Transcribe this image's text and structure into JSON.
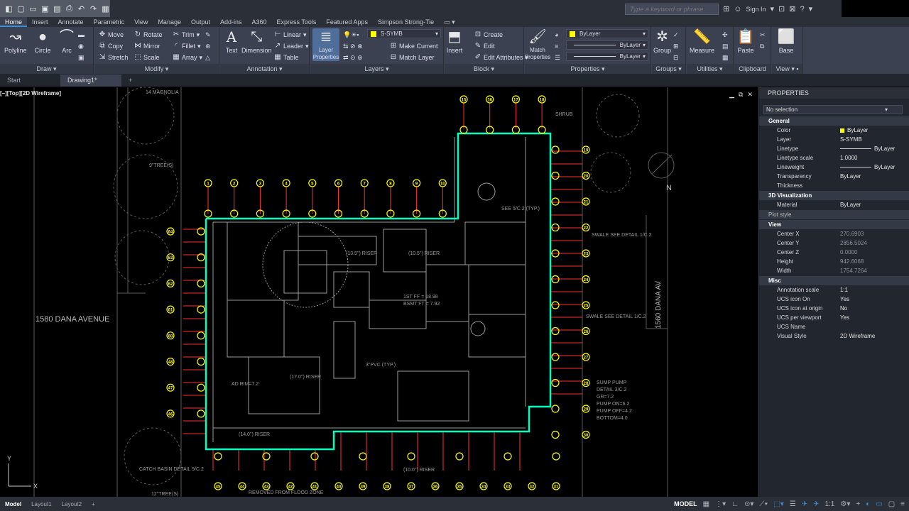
{
  "qat": [
    "new-icon",
    "open-icon",
    "save-icon",
    "saveas-icon",
    "print-icon",
    "undo-icon",
    "redo-icon",
    "share-icon"
  ],
  "search": {
    "placeholder": "Type a keyword or phrase",
    "signin": "Sign In"
  },
  "tabs": [
    "Home",
    "Insert",
    "Annotate",
    "Parametric",
    "View",
    "Manage",
    "Output",
    "Add-ins",
    "A360",
    "Express Tools",
    "Featured Apps",
    "Simpson Strong-Tie"
  ],
  "ribbon": {
    "draw": {
      "title": "Draw",
      "polyline": "Polyline",
      "circle": "Circle",
      "arc": "Arc"
    },
    "modify": {
      "title": "Modify",
      "move": "Move",
      "rotate": "Rotate",
      "trim": "Trim",
      "copy": "Copy",
      "mirror": "Mirror",
      "fillet": "Fillet",
      "stretch": "Stretch",
      "scale": "Scale",
      "array": "Array"
    },
    "annotation": {
      "title": "Annotation",
      "text": "Text",
      "dimension": "Dimension",
      "linear": "Linear",
      "leader": "Leader",
      "table": "Table"
    },
    "layers": {
      "title": "Layers",
      "layer_properties": "Layer Properties",
      "current_layer": "S-SYMB",
      "make_current": "Make Current",
      "match_layer": "Match Layer"
    },
    "block": {
      "title": "Block",
      "insert": "Insert",
      "create": "Create",
      "edit": "Edit",
      "edit_attributes": "Edit Attributes"
    },
    "properties": {
      "title": "Properties",
      "match_properties": "Match Properties",
      "color": "ByLayer",
      "linetype": "ByLayer",
      "lineweight": "ByLayer"
    },
    "groups": {
      "title": "Groups",
      "group": "Group"
    },
    "utilities": {
      "title": "Utilities",
      "measure": "Measure"
    },
    "clipboard": {
      "title": "Clipboard",
      "paste": "Paste"
    },
    "view": {
      "title": "View",
      "base": "Base"
    }
  },
  "doc_tabs": {
    "start": "Start",
    "drawing": "Drawing1*"
  },
  "viewport": {
    "label": "[–][Top][2D Wireframe]"
  },
  "drawing": {
    "street_left": "1580 DANA AVENUE",
    "street_right": "1560 DANA AV",
    "north": "N",
    "notes": [
      "14 MAGNOLIA",
      "9\"TREE(S)",
      "12\"TREE(S)",
      "SHRUB",
      "SWALE SEE DETAIL 1/C.2",
      "SUMP PUMP",
      "DETAIL 3/C.2",
      "GR=7.2",
      "PUMP ON=6.2",
      "PUMP OFF=4.2",
      "BOTTOM=4.0",
      "1ST FF = 18.98",
      "BSMT FT = 7.92",
      "AD RIM=7.2",
      "CATCH BASIN DETAIL 9/C.2",
      "REMOVED FROM FLOOD ZONE",
      "SEE 5/C.2 (TYP.)",
      "3\"PVC (TYP.)",
      "SWALE SEE DETAIL 1/C.2",
      "(13.5\") RISER",
      "(10.5\") RISER",
      "(17.0\") RISER",
      "(14.0\") RISER",
      "(10.0\") RISER"
    ],
    "top_markers": [
      "1",
      "2",
      "3",
      "4",
      "5",
      "6",
      "7",
      "8",
      "9",
      "10"
    ],
    "top_right_markers": [
      "15",
      "16",
      "17",
      "18"
    ],
    "left_markers": [
      "64",
      "63",
      "62",
      "61",
      "60",
      "48",
      "47",
      "46"
    ],
    "right_markers": [
      "19",
      "20",
      "21",
      "22",
      "23",
      "24",
      "25",
      "26",
      "27",
      "28",
      "29",
      "30"
    ],
    "bottom_markers": [
      "45",
      "44",
      "43",
      "42",
      "41",
      "40",
      "39",
      "38",
      "37",
      "36",
      "35",
      "34",
      "33",
      "32",
      "31"
    ]
  },
  "properties_panel": {
    "title": "PROPERTIES",
    "selection": "No selection",
    "general": {
      "title": "General",
      "rows": [
        {
          "name": "Color",
          "value": "ByLayer",
          "swatch": "#ffff00"
        },
        {
          "name": "Layer",
          "value": "S-SYMB"
        },
        {
          "name": "Linetype",
          "value": "ByLayer"
        },
        {
          "name": "Linetype scale",
          "value": "1.0000"
        },
        {
          "name": "Lineweight",
          "value": "ByLayer"
        },
        {
          "name": "Transparency",
          "value": "ByLayer"
        },
        {
          "name": "Thickness",
          "value": ""
        }
      ]
    },
    "viz": {
      "title": "3D Visualization",
      "rows": [
        {
          "name": "Material",
          "value": "ByLayer"
        }
      ]
    },
    "plot": {
      "title": "Plot style"
    },
    "view": {
      "title": "View",
      "rows": [
        {
          "name": "Center X",
          "value": "270.6903"
        },
        {
          "name": "Center Y",
          "value": "2856.5024"
        },
        {
          "name": "Center Z",
          "value": "0.0000"
        },
        {
          "name": "Height",
          "value": "942.6068"
        },
        {
          "name": "Width",
          "value": "1754.7264"
        }
      ]
    },
    "misc": {
      "title": "Misc",
      "rows": [
        {
          "name": "Annotation scale",
          "value": "1:1"
        },
        {
          "name": "UCS icon On",
          "value": "Yes"
        },
        {
          "name": "UCS icon at origin",
          "value": "No"
        },
        {
          "name": "UCS per viewport",
          "value": "Yes"
        },
        {
          "name": "UCS Name",
          "value": ""
        },
        {
          "name": "Visual Style",
          "value": "2D Wireframe"
        }
      ]
    }
  },
  "layout_tabs": [
    "Model",
    "Layout1",
    "Layout2"
  ],
  "status": {
    "model": "MODEL",
    "scale": "1:1"
  },
  "colors": {
    "accent": "#3b8fd8",
    "marker": "#ffff00",
    "boundary": "#00ffbf",
    "dim": "#ff3030",
    "ribbon": "#3b4150"
  }
}
